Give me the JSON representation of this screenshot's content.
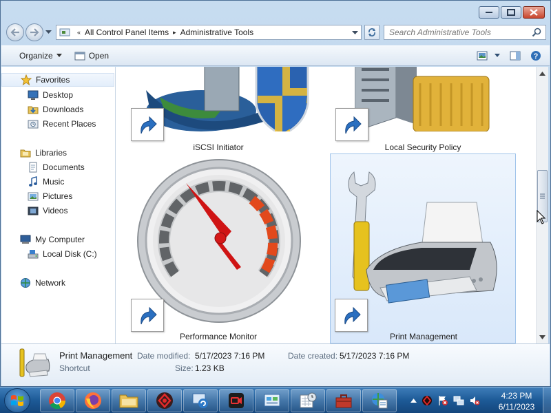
{
  "window": {
    "address": {
      "crumbs": [
        "All Control Panel Items",
        "Administrative Tools"
      ],
      "overflow": "«",
      "separator": "▸"
    },
    "search_placeholder": "Search Administrative Tools"
  },
  "toolbar": {
    "organize": "Organize",
    "open": "Open"
  },
  "navpane": {
    "favorites": "Favorites",
    "favorites_items": [
      "Desktop",
      "Downloads",
      "Recent Places"
    ],
    "libraries": "Libraries",
    "libraries_items": [
      "Documents",
      "Music",
      "Pictures",
      "Videos"
    ],
    "computer": "My Computer",
    "computer_items": [
      "Local Disk (C:)"
    ],
    "network": "Network"
  },
  "items": [
    {
      "label": "iSCSI Initiator"
    },
    {
      "label": "Local Security Policy"
    },
    {
      "label": "Performance Monitor"
    },
    {
      "label": "Print Management",
      "selected": true
    }
  ],
  "details": {
    "name": "Print Management",
    "type": "Shortcut",
    "date_modified_label": "Date modified:",
    "date_modified": "5/17/2023 7:16 PM",
    "date_created_label": "Date created:",
    "date_created": "5/17/2023 7:16 PM",
    "size_label": "Size:",
    "size": "1.23 KB"
  },
  "taskbar": {
    "time": "4:23 PM",
    "date": "6/11/2023"
  },
  "colors": {
    "accent": "#3b78b4",
    "selection": "#d9e8fa",
    "close": "#c8452c"
  }
}
